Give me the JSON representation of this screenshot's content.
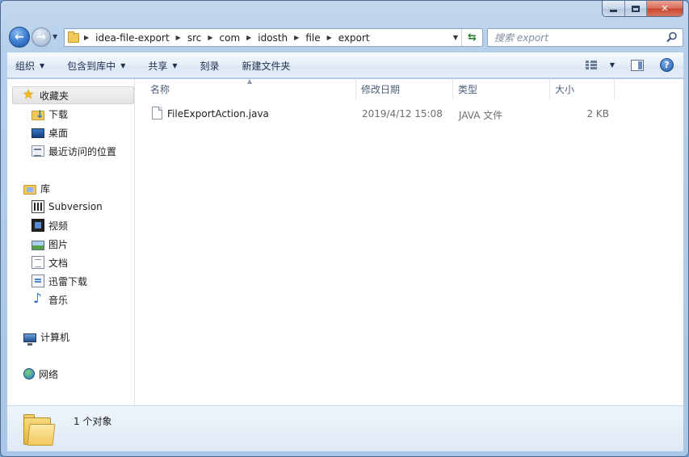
{
  "window": {
    "minimize_label": "",
    "maximize_label": "",
    "close_label": "✕"
  },
  "navigation": {
    "back_glyph": "←",
    "forward_glyph": "→",
    "breadcrumbs": [
      "idea-file-export",
      "src",
      "com",
      "idosth",
      "file",
      "export"
    ],
    "refresh_glyph": "⇆"
  },
  "search": {
    "placeholder": "搜索 export"
  },
  "toolbar": {
    "organize": "组织",
    "include_in_library": "包含到库中",
    "share": "共享",
    "burn": "刻录",
    "new_folder": "新建文件夹",
    "help_glyph": "?"
  },
  "sidebar": {
    "favorites": {
      "label": "收藏夹",
      "icon": "star-icon",
      "items": [
        {
          "label": "下载",
          "icon": "download-folder-icon"
        },
        {
          "label": "桌面",
          "icon": "desktop-icon"
        },
        {
          "label": "最近访问的位置",
          "icon": "recent-places-icon"
        }
      ]
    },
    "libraries": {
      "label": "库",
      "icon": "library-icon",
      "items": [
        {
          "label": "Subversion",
          "icon": "subversion-icon"
        },
        {
          "label": "视频",
          "icon": "video-icon"
        },
        {
          "label": "图片",
          "icon": "picture-icon"
        },
        {
          "label": "文档",
          "icon": "document-icon"
        },
        {
          "label": "迅雷下载",
          "icon": "thunder-download-icon"
        },
        {
          "label": "音乐",
          "icon": "music-icon"
        }
      ]
    },
    "computer": {
      "label": "计算机",
      "icon": "computer-icon"
    },
    "network": {
      "label": "网络",
      "icon": "network-icon"
    }
  },
  "filelist": {
    "columns": [
      "名称",
      "修改日期",
      "类型",
      "大小"
    ],
    "rows": [
      {
        "name": "FileExportAction.java",
        "modified": "2019/4/12 15:08",
        "type": "JAVA 文件",
        "size": "2 KB"
      }
    ]
  },
  "status": {
    "count_text": "1 个对象"
  }
}
